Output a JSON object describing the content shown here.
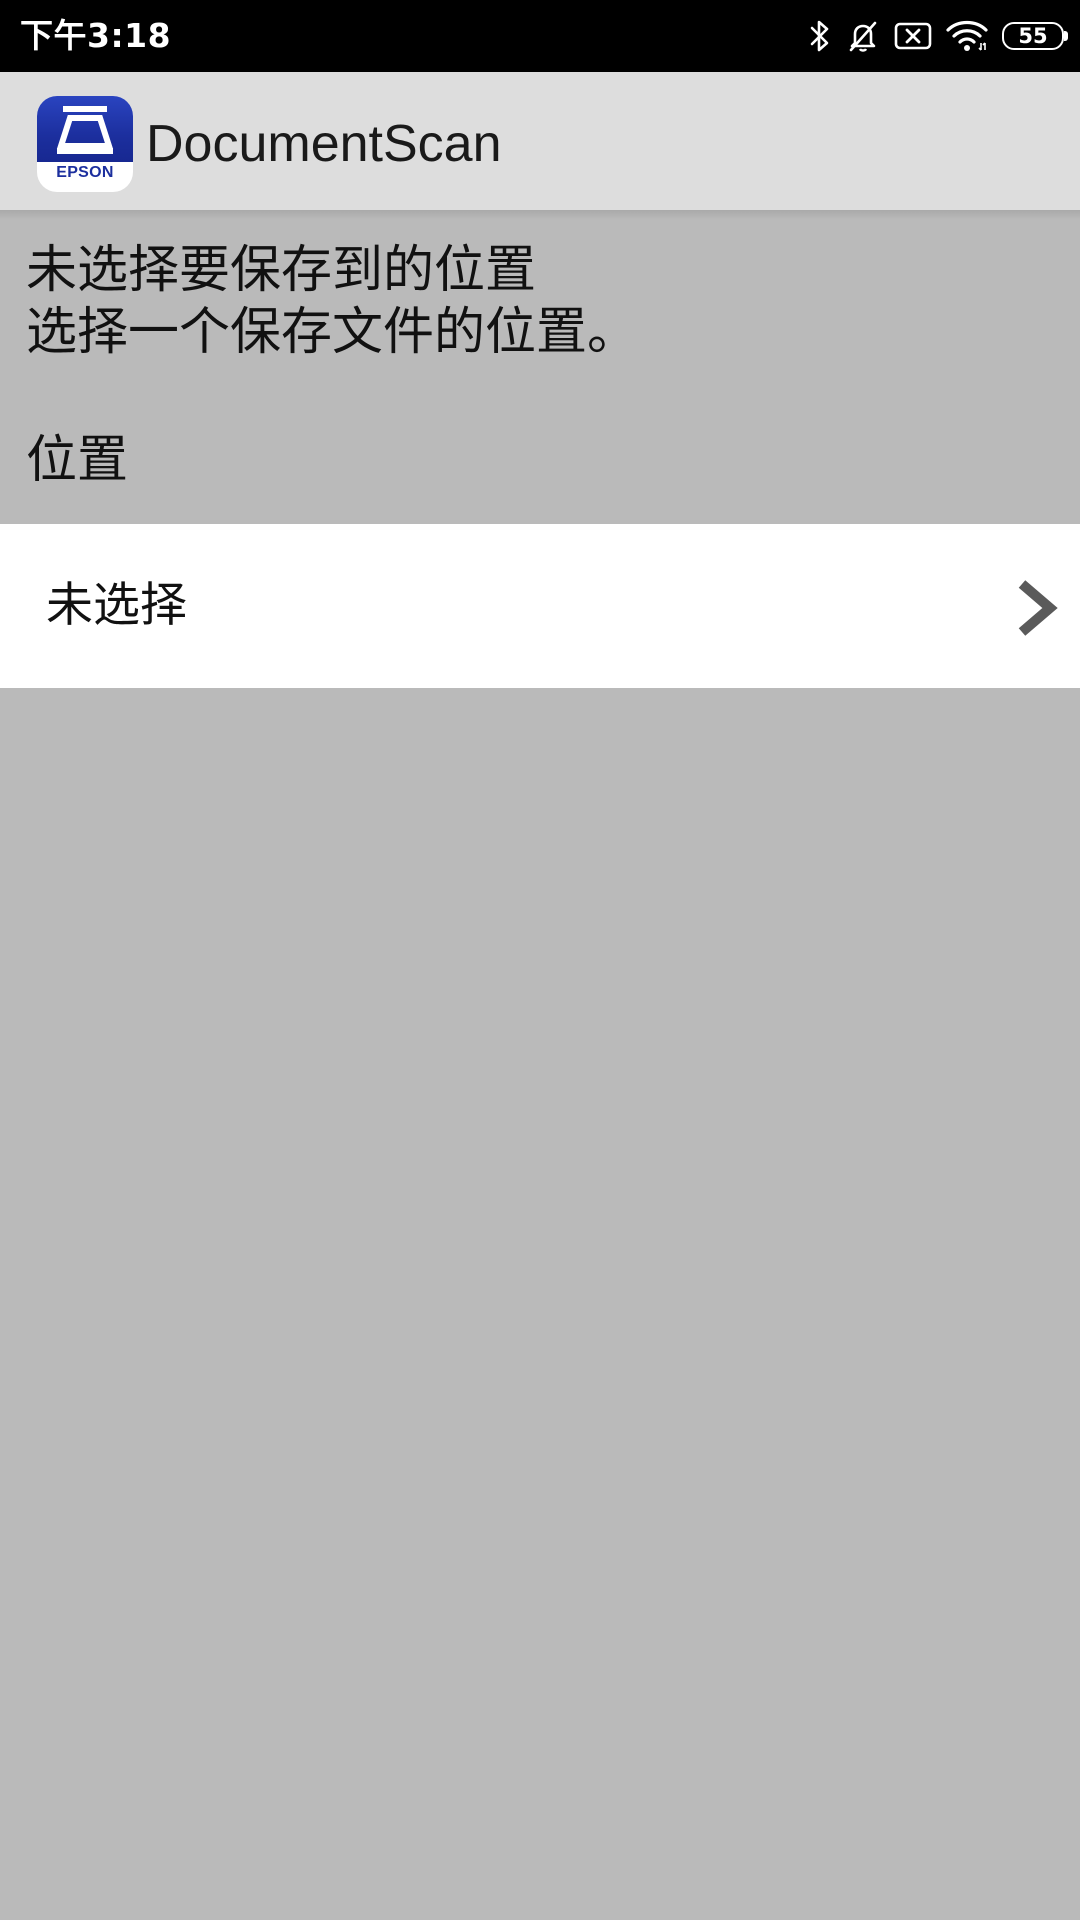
{
  "status_bar": {
    "time": "下午3:18",
    "battery_level": "55",
    "icons": [
      "bluetooth-icon",
      "notifications-off-icon",
      "no-sim-icon",
      "wifi-icon",
      "battery-icon"
    ]
  },
  "app_bar": {
    "title": "DocumentScan",
    "logo_text": "EPSON"
  },
  "message": {
    "line1": "未选择要保存到的位置",
    "line2": "选择一个保存文件的位置。"
  },
  "section": {
    "label": "位置"
  },
  "location_row": {
    "value": "未选择",
    "icon": "chevron-right-icon"
  },
  "colors": {
    "status_bar_bg": "#000000",
    "app_bar_bg": "#dddddd",
    "page_bg": "#bababa",
    "row_bg": "#ffffff",
    "logo_blue": "#1c2f9e"
  }
}
